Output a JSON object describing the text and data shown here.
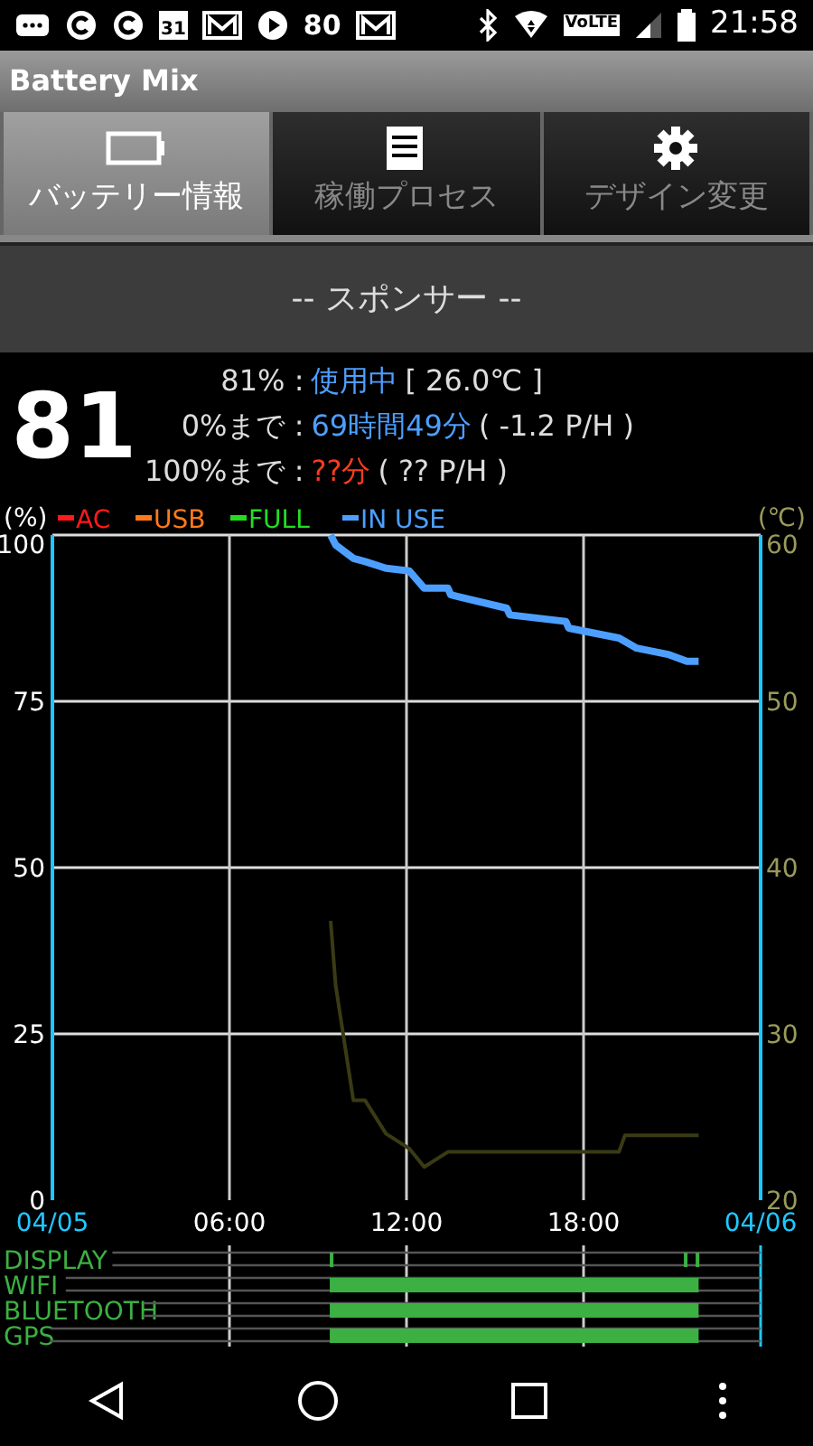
{
  "status_bar": {
    "calendar_day": "31",
    "badge_number": "80",
    "network_label": "VoLTE",
    "time": "21:58"
  },
  "app_title": "Battery Mix",
  "tabs": [
    {
      "label": "バッテリー情報",
      "selected": true
    },
    {
      "label": "稼働プロセス",
      "selected": false
    },
    {
      "label": "デザイン変更",
      "selected": false
    }
  ],
  "sponsor_banner": "-- スポンサー --",
  "battery": {
    "percent": "81",
    "rows": [
      {
        "label": "81% :",
        "value": "使用中",
        "color": "#4d9fff",
        "detail": "[ 26.0℃ ]"
      },
      {
        "label": "0%まで :",
        "value": "69時間49分",
        "color": "#4d9fff",
        "detail": "( -1.2 P/H )"
      },
      {
        "label": "100%まで :",
        "value": "??分",
        "color": "#ff3b1f",
        "detail": "( ?? P/H )"
      }
    ]
  },
  "chart": {
    "legend": [
      {
        "label": "AC",
        "color": "#ff1a1a"
      },
      {
        "label": "USB",
        "color": "#ff7a1a"
      },
      {
        "label": "FULL",
        "color": "#22dd22"
      }
    ],
    "date_labels": [
      "04/05",
      "04/06"
    ],
    "chart_data": {
      "type": "line",
      "grid": true,
      "ylabel": "(%)",
      "y2label": "(℃)",
      "xlim": [
        0,
        24
      ],
      "ylim": [
        0,
        100
      ],
      "y2lim": [
        20,
        60
      ],
      "xticks": [
        {
          "value": 6,
          "label": "06:00"
        },
        {
          "value": 12,
          "label": "12:00"
        },
        {
          "value": 18,
          "label": "18:00"
        }
      ],
      "yticks": [
        0,
        25,
        50,
        75,
        100
      ],
      "y2ticks": [
        20,
        30,
        40,
        50,
        60
      ],
      "x": [
        9.43,
        9.6,
        10.2,
        10.6,
        11.3,
        12.1,
        12.6,
        13.4,
        13.5,
        15.4,
        15.5,
        17.4,
        17.5,
        19.2,
        19.4,
        19.8,
        20.9,
        21.5,
        21.9
      ],
      "series": [
        {
          "name": "IN USE",
          "color": "#4d9fff",
          "values": [
            100,
            98.5,
            96.5,
            96,
            95,
            94.6,
            92,
            92,
            91,
            89,
            88,
            87,
            86,
            84.5,
            84,
            83,
            82,
            81,
            81
          ]
        },
        {
          "color": "#3a3a14",
          "axis": "y2",
          "values": [
            36.8,
            32.9,
            26,
            26,
            24,
            23.1,
            22,
            22.9,
            22.9,
            22.9,
            22.9,
            22.9,
            22.9,
            22.9,
            23.9,
            23.9,
            23.9,
            23.9,
            23.9
          ]
        }
      ]
    }
  },
  "activity": {
    "rows": [
      {
        "label": "DISPLAY"
      },
      {
        "label": "WIFI"
      },
      {
        "label": "BLUETOOTH"
      },
      {
        "label": "GPS"
      }
    ]
  }
}
